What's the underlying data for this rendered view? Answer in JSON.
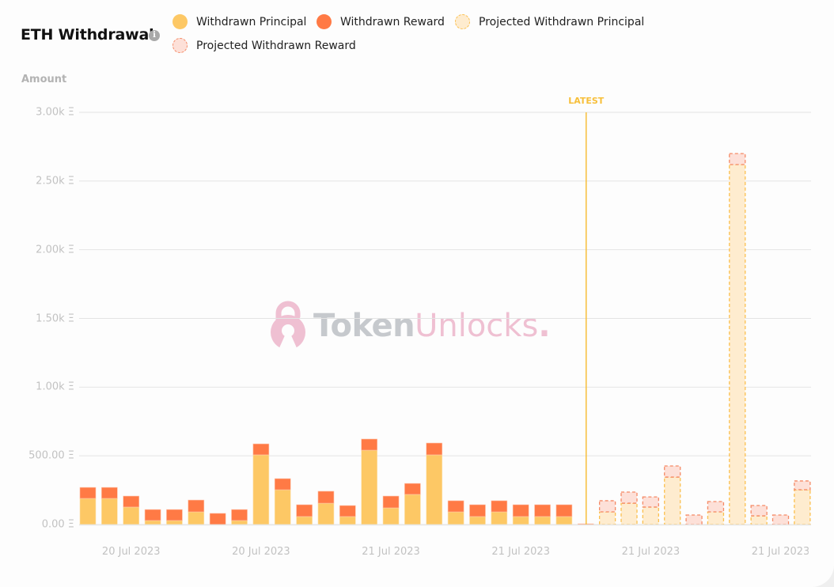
{
  "header": {
    "title": "ETH Withdrawal",
    "info_icon": "info-icon"
  },
  "legend": [
    {
      "label": "Withdrawn Principal",
      "color": "#fdc865",
      "style": "solid"
    },
    {
      "label": "Withdrawn Reward",
      "color": "#ff7a45",
      "style": "solid"
    },
    {
      "label": "Projected Withdrawn Principal",
      "color": "#feeccf",
      "border": "#fbc04f",
      "style": "dashed"
    },
    {
      "label": "Projected Withdrawn Reward",
      "color": "#fde0d8",
      "border": "#f58a66",
      "style": "dashed"
    }
  ],
  "watermark": {
    "part1": "Token",
    "part2": "Unlocks",
    "part3": "."
  },
  "colors": {
    "principal": "#fdc865",
    "reward": "#ff7a45",
    "projected_principal_fill": "#feeccf",
    "projected_principal_border": "#fbc04f",
    "projected_reward_fill": "#fde0d8",
    "projected_reward_border": "#f58a66",
    "latest_line": "#f7bf3a",
    "grid": "#e4e4e4"
  },
  "chart_data": {
    "type": "bar",
    "stacked": true,
    "title": "ETH Withdrawal",
    "ylabel": "Amount",
    "xlabel": "",
    "ylim": [
      0,
      3000
    ],
    "grid": true,
    "yticks": [
      0,
      500,
      1000,
      1500,
      2000,
      2500,
      3000
    ],
    "ytick_labels": [
      "0.00 Ξ",
      "500.00 Ξ",
      "1.00k Ξ",
      "1.50k Ξ",
      "2.00k Ξ",
      "2.50k Ξ",
      "3.00k Ξ"
    ],
    "xtick_labels": [
      {
        "index": 2,
        "label": "20 Jul 2023"
      },
      {
        "index": 8,
        "label": "20 Jul 2023"
      },
      {
        "index": 14,
        "label": "21 Jul 2023"
      },
      {
        "index": 20,
        "label": "21 Jul 2023"
      },
      {
        "index": 26,
        "label": "21 Jul 2023"
      },
      {
        "index": 32,
        "label": "21 Jul 2023"
      }
    ],
    "latest_marker": {
      "label": "LATEST",
      "after_index": 23
    },
    "legend_position": "top",
    "series": [
      {
        "name": "Withdrawn Principal",
        "values": [
          190,
          190,
          127,
          29,
          29,
          92,
          0,
          29,
          507,
          253,
          58,
          155,
          58,
          541,
          121,
          219,
          507,
          92,
          58,
          92,
          58,
          58,
          58,
          0,
          null,
          null,
          null,
          null,
          null,
          null,
          null,
          null,
          null,
          null
        ]
      },
      {
        "name": "Withdrawn Reward",
        "values": [
          80,
          80,
          80,
          80,
          80,
          86,
          81,
          80,
          80,
          81,
          86,
          87,
          80,
          81,
          86,
          80,
          86,
          81,
          86,
          81,
          86,
          86,
          86,
          5,
          null,
          null,
          null,
          null,
          null,
          null,
          null,
          null,
          null,
          null
        ]
      },
      {
        "name": "Projected Withdrawn Principal",
        "values": [
          null,
          null,
          null,
          null,
          null,
          null,
          null,
          null,
          null,
          null,
          null,
          null,
          null,
          null,
          null,
          null,
          null,
          null,
          null,
          null,
          null,
          null,
          null,
          null,
          92,
          155,
          127,
          345,
          0,
          92,
          2620,
          63,
          0,
          253
        ]
      },
      {
        "name": "Projected Withdrawn Reward",
        "values": [
          null,
          null,
          null,
          null,
          null,
          null,
          null,
          null,
          null,
          null,
          null,
          null,
          null,
          null,
          null,
          null,
          null,
          null,
          null,
          null,
          null,
          null,
          null,
          null,
          81,
          81,
          74,
          81,
          69,
          75,
          80,
          75,
          69,
          64
        ]
      }
    ]
  }
}
